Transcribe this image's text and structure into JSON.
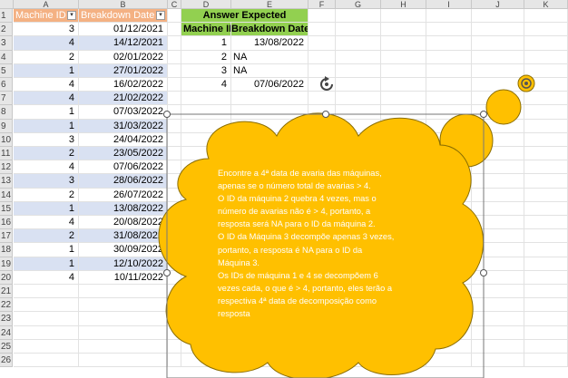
{
  "columns": [
    "A",
    "B",
    "C",
    "D",
    "E",
    "F",
    "G",
    "H",
    "I",
    "J",
    "K"
  ],
  "rows": [
    "1",
    "2",
    "3",
    "4",
    "5",
    "6",
    "7",
    "8",
    "9",
    "10",
    "11",
    "12",
    "13",
    "14",
    "15",
    "16",
    "17",
    "18",
    "19",
    "20",
    "21",
    "22",
    "23",
    "24",
    "25",
    "26"
  ],
  "table": {
    "headers": [
      "Machine ID",
      "Breakdown Date"
    ],
    "rows": [
      [
        "3",
        "01/12/2021"
      ],
      [
        "4",
        "14/12/2021"
      ],
      [
        "2",
        "02/01/2022"
      ],
      [
        "1",
        "27/01/2022"
      ],
      [
        "4",
        "16/02/2022"
      ],
      [
        "4",
        "21/02/2022"
      ],
      [
        "1",
        "07/03/2022"
      ],
      [
        "1",
        "31/03/2022"
      ],
      [
        "3",
        "24/04/2022"
      ],
      [
        "2",
        "23/05/2022"
      ],
      [
        "4",
        "07/06/2022"
      ],
      [
        "3",
        "28/06/2022"
      ],
      [
        "2",
        "26/07/2022"
      ],
      [
        "1",
        "13/08/2022"
      ],
      [
        "4",
        "20/08/2022"
      ],
      [
        "2",
        "31/08/2022"
      ],
      [
        "1",
        "30/09/2022"
      ],
      [
        "1",
        "12/10/2022"
      ],
      [
        "4",
        "10/11/2022"
      ]
    ]
  },
  "answer": {
    "title": "Answer Expected",
    "headers": [
      "Machine ID",
      "Breakdown Date"
    ],
    "rows": [
      [
        "1",
        "13/08/2022"
      ],
      [
        "2",
        "NA"
      ],
      [
        "3",
        "NA"
      ],
      [
        "4",
        "07/06/2022"
      ]
    ]
  },
  "callout": {
    "lines": [
      "Encontre a 4ª data de avaria das máquinas,",
      "apenas se o número total de avarias > 4.",
      "O ID da máquina 2 quebra 4 vezes, mas o",
      "número de avarias não é > 4, portanto, a",
      "resposta será NA para o ID da máquina 2.",
      "O ID da Máquina 3 decompõe apenas 3 vezes,",
      "portanto, a resposta é NA para o ID da",
      "Máquina 3.",
      "Os IDs de máquina 1 e 4 se decompõem 6",
      "vezes cada, o que é > 4, portanto, eles terão a",
      "respectiva 4ª data de decomposição como",
      "resposta"
    ],
    "fill_color": "#ffc000",
    "outline_color": "#8a6d00"
  },
  "colors": {
    "header_fill": "#f4b183",
    "band_fill": "#d9e1f2",
    "answer_fill": "#92d050"
  }
}
